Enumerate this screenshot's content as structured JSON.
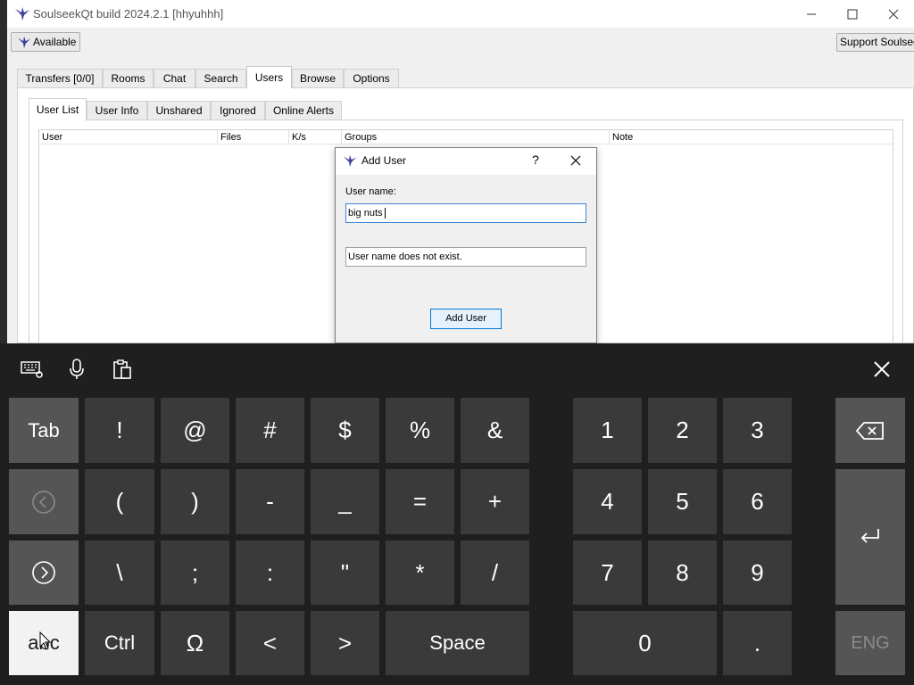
{
  "window": {
    "title": "SoulseekQt build 2024.2.1 [hhyuhhh]",
    "status_button": "Available",
    "support_button": "Support Soulseek"
  },
  "main_tabs": [
    "Transfers [0/0]",
    "Rooms",
    "Chat",
    "Search",
    "Users",
    "Browse",
    "Options"
  ],
  "active_main_tab": "Users",
  "sub_tabs": [
    "User List",
    "User Info",
    "Unshared",
    "Ignored",
    "Online Alerts"
  ],
  "active_sub_tab": "User List",
  "table": {
    "columns": [
      "User",
      "Files",
      "K/s",
      "Groups",
      "Note"
    ]
  },
  "dialog": {
    "title": "Add User",
    "help": "?",
    "username_label": "User name:",
    "username_value": "big nuts",
    "status_message": "User name does not exist.",
    "add_button": "Add User"
  },
  "keyboard": {
    "row1": [
      "Tab",
      "!",
      "@",
      "#",
      "$",
      "%",
      "&",
      "1",
      "2",
      "3"
    ],
    "row2": [
      "(",
      ")",
      "-",
      "_",
      "=",
      "+",
      "4",
      "5",
      "6"
    ],
    "row3": [
      "\\",
      ";",
      ":",
      "\"",
      "*",
      "/",
      "7",
      "8",
      "9"
    ],
    "row4": {
      "abc": "abc",
      "ctrl": "Ctrl",
      "omega": "Ω",
      "left": "<",
      "right": ">",
      "space": "Space",
      "zero": "0",
      "dot": ".",
      "lang": "ENG"
    }
  }
}
